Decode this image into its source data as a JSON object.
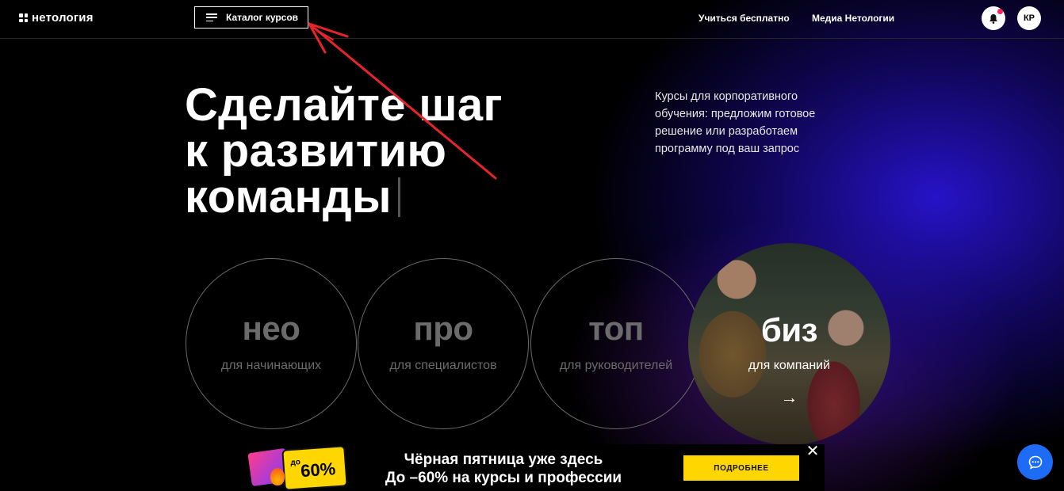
{
  "header": {
    "logo_text": "нетология",
    "catalog_label": "Каталог курсов",
    "nav": [
      "Учиться бесплатно",
      "Медиа Нетологии"
    ],
    "avatar_initials": "КР"
  },
  "hero": {
    "title_lines": [
      "Сделайте шаг",
      "к развитию",
      "команды"
    ],
    "description": "Курсы для корпоративного обучения: предложим готовое решение или разработаем программу под ваш запрос"
  },
  "levels": [
    {
      "name": "нео",
      "caption": "для начинающих"
    },
    {
      "name": "про",
      "caption": "для специалистов"
    },
    {
      "name": "топ",
      "caption": "для руководителей"
    },
    {
      "name": "биз",
      "caption": "для компаний"
    }
  ],
  "banner": {
    "badge_prefix": "до",
    "badge_value": "60%",
    "line1": "Чёрная пятница уже здесь",
    "line2": "До –60% на курсы и профессии",
    "button_label": "ПОДРОБНЕЕ"
  },
  "colors": {
    "accent_yellow": "#ffd600",
    "chat_blue": "#1e6cf5",
    "notification_dot": "#ff1f5a",
    "annotation_red": "#e8242b"
  }
}
